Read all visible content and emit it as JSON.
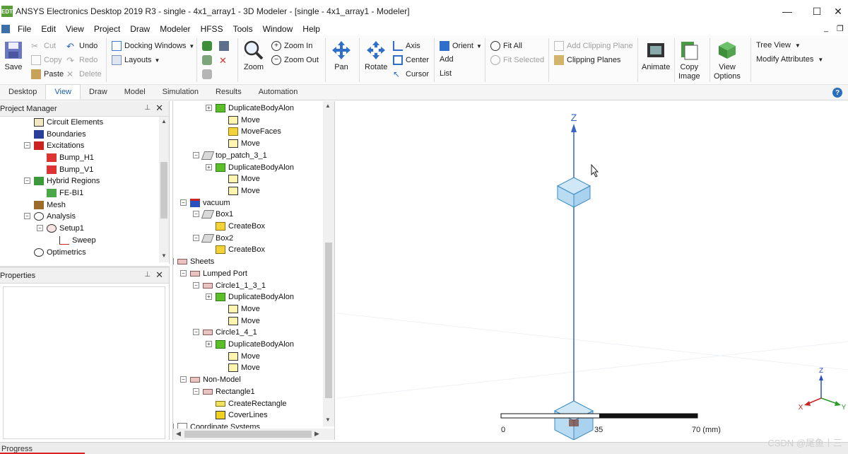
{
  "titlebar": {
    "app_icon_text": "EDT",
    "title": "ANSYS Electronics Desktop 2019 R3 - single - 4x1_array1 - 3D Modeler - [single - 4x1_array1 - Modeler]",
    "minimize": "—",
    "maximize": "☐",
    "close": "✕"
  },
  "menubar": {
    "items": [
      "File",
      "Edit",
      "View",
      "Project",
      "Draw",
      "Modeler",
      "HFSS",
      "Tools",
      "Window",
      "Help"
    ],
    "doc_minimize": "_",
    "doc_restore": "❐"
  },
  "ribbon": {
    "save": "Save",
    "cut": "Cut",
    "copy": "Copy",
    "paste": "Paste",
    "undo": "Undo",
    "redo": "Redo",
    "delete": "Delete",
    "docking_windows": "Docking Windows",
    "layouts": "Layouts",
    "zoom": "Zoom",
    "zoom_in": "Zoom In",
    "zoom_out": "Zoom Out",
    "pan": "Pan",
    "rotate": "Rotate",
    "axis": "Axis",
    "center": "Center",
    "cursor": "Cursor",
    "orient": "Orient",
    "add": "Add",
    "list": "List",
    "fit_all": "Fit All",
    "fit_selected": "Fit Selected",
    "add_clipping_plane": "Add Clipping Plane",
    "clipping_planes": "Clipping Planes",
    "animate": "Animate",
    "copy_image": "Copy\nImage",
    "view_options": "View\nOptions",
    "tree_view": "Tree View",
    "modify_attributes": "Modify Attributes"
  },
  "tabs": [
    "Desktop",
    "View",
    "Draw",
    "Model",
    "Simulation",
    "Results",
    "Automation"
  ],
  "active_tab": "View",
  "help_icon": "?",
  "project_manager": {
    "title": "Project Manager",
    "pin": "📌",
    "close": "✕",
    "items": [
      {
        "label": "Circuit Elements"
      },
      {
        "label": "Boundaries"
      },
      {
        "label": "Excitations"
      },
      {
        "label": "Bump_H1"
      },
      {
        "label": "Bump_V1"
      },
      {
        "label": "Hybrid Regions"
      },
      {
        "label": "FE-BI1"
      },
      {
        "label": "Mesh"
      },
      {
        "label": "Analysis"
      },
      {
        "label": "Setup1"
      },
      {
        "label": "Sweep"
      },
      {
        "label": "Optimetrics"
      }
    ]
  },
  "properties": {
    "title": "Properties",
    "pin": "📌",
    "close": "✕"
  },
  "model_tree": {
    "items": [
      {
        "label": "DuplicateBodyAlon"
      },
      {
        "label": "Move"
      },
      {
        "label": "MoveFaces"
      },
      {
        "label": "Move"
      },
      {
        "label": "top_patch_3_1"
      },
      {
        "label": "DuplicateBodyAlon"
      },
      {
        "label": "Move"
      },
      {
        "label": "Move"
      },
      {
        "label": "vacuum"
      },
      {
        "label": "Box1"
      },
      {
        "label": "CreateBox"
      },
      {
        "label": "Box2"
      },
      {
        "label": "CreateBox"
      },
      {
        "label": "Sheets"
      },
      {
        "label": "Lumped Port"
      },
      {
        "label": "Circle1_1_3_1"
      },
      {
        "label": "DuplicateBodyAlon"
      },
      {
        "label": "Move"
      },
      {
        "label": "Move"
      },
      {
        "label": "Circle1_4_1"
      },
      {
        "label": "DuplicateBodyAlon"
      },
      {
        "label": "Move"
      },
      {
        "label": "Move"
      },
      {
        "label": "Non-Model"
      },
      {
        "label": "Rectangle1"
      },
      {
        "label": "CreateRectangle"
      },
      {
        "label": "CoverLines"
      },
      {
        "label": "Coordinate Systems"
      }
    ]
  },
  "viewport": {
    "z_axis_label": "Z",
    "scale_labels": [
      "0",
      "35",
      "70 (mm)"
    ],
    "triad": {
      "z": "Z",
      "x": "X",
      "y": "Y"
    }
  },
  "status": {
    "progress_label": "Progress"
  },
  "watermark": "CSDN @尾鱼十三"
}
